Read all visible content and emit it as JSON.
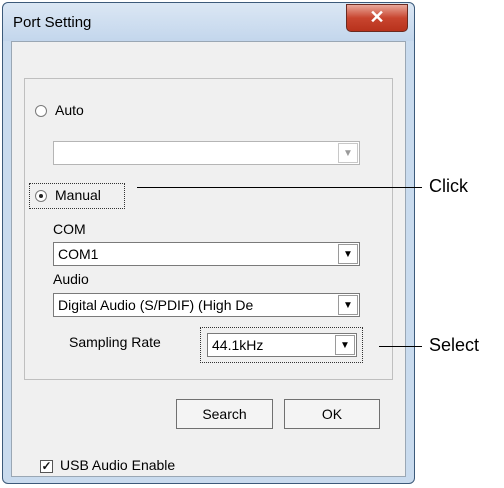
{
  "dialog": {
    "title": "Port Setting",
    "close_icon": "close-icon"
  },
  "connection": {
    "auto_label": "Auto",
    "auto_selected": false,
    "auto_value": "",
    "manual_label": "Manual",
    "manual_selected": true
  },
  "com": {
    "label": "COM",
    "value": "COM1"
  },
  "audio": {
    "label": "Audio",
    "value": "Digital Audio (S/PDIF) (High De",
    "sampling_label": "Sampling Rate",
    "sampling_value": "44.1kHz"
  },
  "buttons": {
    "search": "Search",
    "ok": "OK"
  },
  "usb": {
    "label": "USB Audio Enable",
    "checked": true
  },
  "annotations": {
    "click": "Click",
    "select": "Select"
  }
}
